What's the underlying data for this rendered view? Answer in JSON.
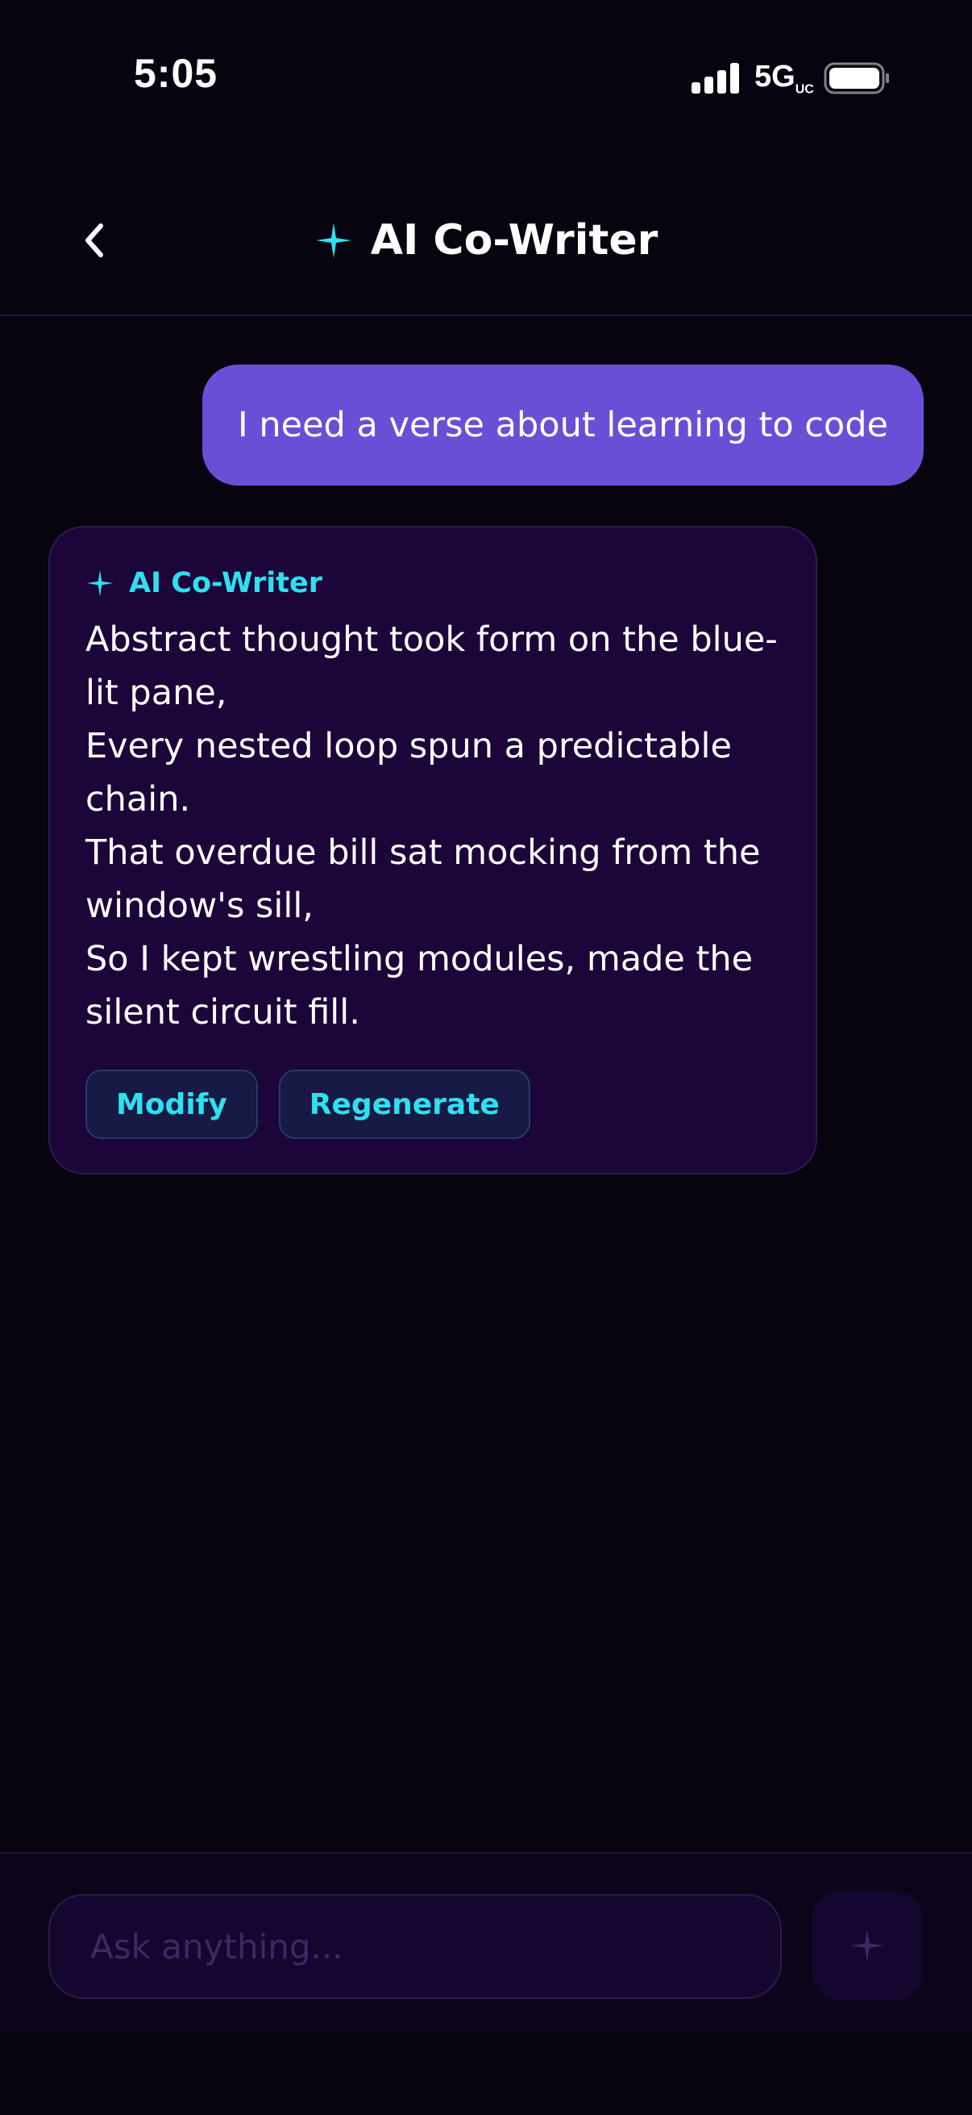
{
  "status_bar": {
    "time": "5:05",
    "network": "5G",
    "network_suffix": "UC",
    "icons": [
      "signal-icon",
      "battery-icon"
    ]
  },
  "header": {
    "title": "AI Co-Writer",
    "icons": [
      "back-chevron-icon",
      "sparkle-icon"
    ]
  },
  "conversation": {
    "user_message": "I need a verse about learning to code",
    "ai_response": {
      "author": "AI Co-Writer",
      "lines": [
        "Abstract thought took form on the blue-lit pane,",
        "Every nested loop spun a predictable chain.",
        "That overdue bill sat mocking from the window's sill,",
        "So I kept wrestling modules, made the silent circuit fill."
      ],
      "actions": {
        "modify": "Modify",
        "regenerate": "Regenerate"
      }
    }
  },
  "composer": {
    "placeholder": "Ask anything...",
    "send_icon": "sparkle-icon"
  },
  "colors": {
    "background": "#07030f",
    "accent_cyan": "#2ee0f0",
    "user_bubble": "#6a4fd6",
    "ai_card": "#1b0539"
  }
}
